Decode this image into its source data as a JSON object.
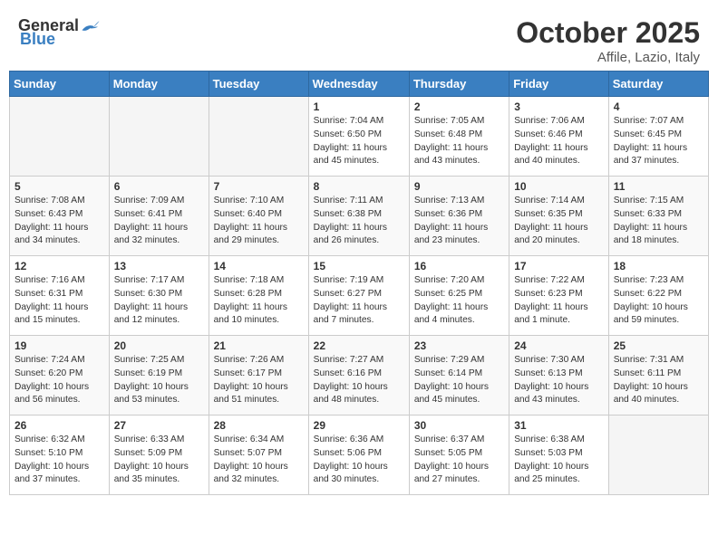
{
  "header": {
    "logo_general": "General",
    "logo_blue": "Blue",
    "month": "October 2025",
    "location": "Affile, Lazio, Italy"
  },
  "days_of_week": [
    "Sunday",
    "Monday",
    "Tuesday",
    "Wednesday",
    "Thursday",
    "Friday",
    "Saturday"
  ],
  "weeks": [
    [
      {
        "day": "",
        "info": ""
      },
      {
        "day": "",
        "info": ""
      },
      {
        "day": "",
        "info": ""
      },
      {
        "day": "1",
        "info": "Sunrise: 7:04 AM\nSunset: 6:50 PM\nDaylight: 11 hours\nand 45 minutes."
      },
      {
        "day": "2",
        "info": "Sunrise: 7:05 AM\nSunset: 6:48 PM\nDaylight: 11 hours\nand 43 minutes."
      },
      {
        "day": "3",
        "info": "Sunrise: 7:06 AM\nSunset: 6:46 PM\nDaylight: 11 hours\nand 40 minutes."
      },
      {
        "day": "4",
        "info": "Sunrise: 7:07 AM\nSunset: 6:45 PM\nDaylight: 11 hours\nand 37 minutes."
      }
    ],
    [
      {
        "day": "5",
        "info": "Sunrise: 7:08 AM\nSunset: 6:43 PM\nDaylight: 11 hours\nand 34 minutes."
      },
      {
        "day": "6",
        "info": "Sunrise: 7:09 AM\nSunset: 6:41 PM\nDaylight: 11 hours\nand 32 minutes."
      },
      {
        "day": "7",
        "info": "Sunrise: 7:10 AM\nSunset: 6:40 PM\nDaylight: 11 hours\nand 29 minutes."
      },
      {
        "day": "8",
        "info": "Sunrise: 7:11 AM\nSunset: 6:38 PM\nDaylight: 11 hours\nand 26 minutes."
      },
      {
        "day": "9",
        "info": "Sunrise: 7:13 AM\nSunset: 6:36 PM\nDaylight: 11 hours\nand 23 minutes."
      },
      {
        "day": "10",
        "info": "Sunrise: 7:14 AM\nSunset: 6:35 PM\nDaylight: 11 hours\nand 20 minutes."
      },
      {
        "day": "11",
        "info": "Sunrise: 7:15 AM\nSunset: 6:33 PM\nDaylight: 11 hours\nand 18 minutes."
      }
    ],
    [
      {
        "day": "12",
        "info": "Sunrise: 7:16 AM\nSunset: 6:31 PM\nDaylight: 11 hours\nand 15 minutes."
      },
      {
        "day": "13",
        "info": "Sunrise: 7:17 AM\nSunset: 6:30 PM\nDaylight: 11 hours\nand 12 minutes."
      },
      {
        "day": "14",
        "info": "Sunrise: 7:18 AM\nSunset: 6:28 PM\nDaylight: 11 hours\nand 10 minutes."
      },
      {
        "day": "15",
        "info": "Sunrise: 7:19 AM\nSunset: 6:27 PM\nDaylight: 11 hours\nand 7 minutes."
      },
      {
        "day": "16",
        "info": "Sunrise: 7:20 AM\nSunset: 6:25 PM\nDaylight: 11 hours\nand 4 minutes."
      },
      {
        "day": "17",
        "info": "Sunrise: 7:22 AM\nSunset: 6:23 PM\nDaylight: 11 hours\nand 1 minute."
      },
      {
        "day": "18",
        "info": "Sunrise: 7:23 AM\nSunset: 6:22 PM\nDaylight: 10 hours\nand 59 minutes."
      }
    ],
    [
      {
        "day": "19",
        "info": "Sunrise: 7:24 AM\nSunset: 6:20 PM\nDaylight: 10 hours\nand 56 minutes."
      },
      {
        "day": "20",
        "info": "Sunrise: 7:25 AM\nSunset: 6:19 PM\nDaylight: 10 hours\nand 53 minutes."
      },
      {
        "day": "21",
        "info": "Sunrise: 7:26 AM\nSunset: 6:17 PM\nDaylight: 10 hours\nand 51 minutes."
      },
      {
        "day": "22",
        "info": "Sunrise: 7:27 AM\nSunset: 6:16 PM\nDaylight: 10 hours\nand 48 minutes."
      },
      {
        "day": "23",
        "info": "Sunrise: 7:29 AM\nSunset: 6:14 PM\nDaylight: 10 hours\nand 45 minutes."
      },
      {
        "day": "24",
        "info": "Sunrise: 7:30 AM\nSunset: 6:13 PM\nDaylight: 10 hours\nand 43 minutes."
      },
      {
        "day": "25",
        "info": "Sunrise: 7:31 AM\nSunset: 6:11 PM\nDaylight: 10 hours\nand 40 minutes."
      }
    ],
    [
      {
        "day": "26",
        "info": "Sunrise: 6:32 AM\nSunset: 5:10 PM\nDaylight: 10 hours\nand 37 minutes."
      },
      {
        "day": "27",
        "info": "Sunrise: 6:33 AM\nSunset: 5:09 PM\nDaylight: 10 hours\nand 35 minutes."
      },
      {
        "day": "28",
        "info": "Sunrise: 6:34 AM\nSunset: 5:07 PM\nDaylight: 10 hours\nand 32 minutes."
      },
      {
        "day": "29",
        "info": "Sunrise: 6:36 AM\nSunset: 5:06 PM\nDaylight: 10 hours\nand 30 minutes."
      },
      {
        "day": "30",
        "info": "Sunrise: 6:37 AM\nSunset: 5:05 PM\nDaylight: 10 hours\nand 27 minutes."
      },
      {
        "day": "31",
        "info": "Sunrise: 6:38 AM\nSunset: 5:03 PM\nDaylight: 10 hours\nand 25 minutes."
      },
      {
        "day": "",
        "info": ""
      }
    ]
  ]
}
